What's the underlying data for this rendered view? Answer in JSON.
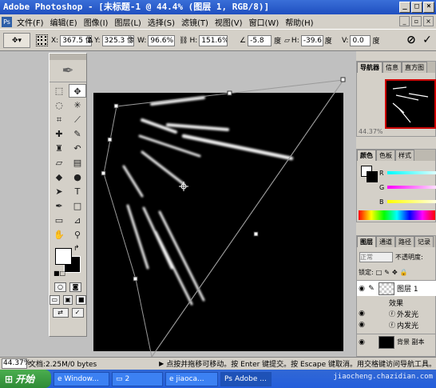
{
  "window": {
    "title": "Adobe Photoshop - [未标题-1 @ 44.4% (图层 1, RGB/8)]"
  },
  "menu": [
    "文件(F)",
    "编辑(E)",
    "图像(I)",
    "图层(L)",
    "选择(S)",
    "滤镜(T)",
    "视图(V)",
    "窗口(W)",
    "帮助(H)"
  ],
  "options": {
    "x_label": "X:",
    "x_value": "367.5 像",
    "y_label": "Y:",
    "y_value": "325.3 像",
    "w_label": "W:",
    "w_value": "96.6%",
    "h_label": "H:",
    "h_value": "151.6%",
    "angle_value": "-5.8",
    "angle_unit": "度",
    "hskew_label": "H:",
    "hskew_value": "-39.6",
    "hskew_unit": "度",
    "vskew_label": "V:",
    "vskew_value": "0.0",
    "vskew_unit": "度"
  },
  "panels": {
    "navigator_tabs": [
      "导航器",
      "信息",
      "直方图"
    ],
    "nav_zoom": "44.37%",
    "color_tabs": [
      "颜色",
      "色板",
      "样式"
    ],
    "color_labels": [
      "R",
      "G",
      "B"
    ],
    "layers_tabs": [
      "图层",
      "通道",
      "路径",
      "记录"
    ],
    "blend_mode": "正常",
    "opacity_label": "不透明度:",
    "lock_label": "锁定:",
    "layer_name": "图层 1",
    "effects_label": "效果",
    "effect_1": "外发光",
    "effect_2": "内发光",
    "bottom_layer": "背景 副本"
  },
  "status": {
    "zoom": "44.37%",
    "doc": "文档:2.25M/0 bytes",
    "hint": "点按并拖移可移动。按 Enter 键提交。按 Escape 键取消。用交格键访问导航工具。"
  },
  "taskbar": {
    "start": "开始",
    "tasks": [
      "Window...",
      "2",
      "jiaoca...",
      "Adobe ..."
    ]
  },
  "watermark": "jiaocheng.chazidian.com"
}
